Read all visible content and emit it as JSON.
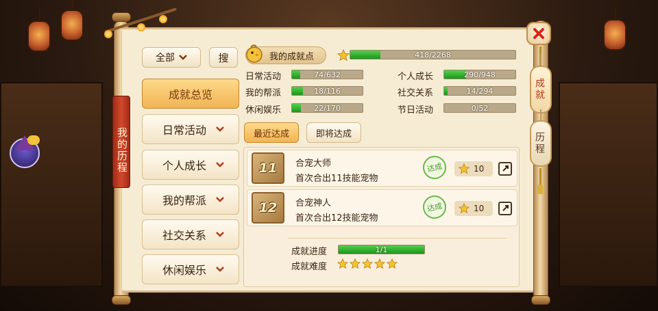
{
  "sidebar_banner": "我的历程",
  "right_tabs": [
    "成就",
    "历程"
  ],
  "filter": {
    "label": "全部",
    "search_label": "搜"
  },
  "menu": [
    {
      "label": "成就总览",
      "active": true
    },
    {
      "label": "日常活动",
      "active": false
    },
    {
      "label": "个人成长",
      "active": false
    },
    {
      "label": "我的帮派",
      "active": false
    },
    {
      "label": "社交关系",
      "active": false
    },
    {
      "label": "休闲娱乐",
      "active": false
    }
  ],
  "header": {
    "my_points_label": "我的成就点",
    "total": {
      "text": "418/2268",
      "progress": 0.184
    }
  },
  "categories": [
    {
      "label": "日常活动",
      "text": "74/632",
      "progress": 0.117
    },
    {
      "label": "个人成长",
      "text": "290/948",
      "progress": 0.306
    },
    {
      "label": "我的帮派",
      "text": "18/116",
      "progress": 0.155
    },
    {
      "label": "社交关系",
      "text": "14/294",
      "progress": 0.048
    },
    {
      "label": "休闲娱乐",
      "text": "22/170",
      "progress": 0.129
    },
    {
      "label": "节日活动",
      "text": "0/52",
      "progress": 0.0
    }
  ],
  "tabs": {
    "recent": "最近达成",
    "upcoming": "即将达成"
  },
  "achievements": [
    {
      "level": "11",
      "name": "合宠大师",
      "desc": "首次合出11技能宠物",
      "status": "达成",
      "points": "10"
    },
    {
      "level": "12",
      "name": "合宠神人",
      "desc": "首次合出12技能宠物",
      "status": "达成",
      "points": "10"
    }
  ],
  "detail": {
    "progress_label": "成就进度",
    "progress_text": "1/1",
    "progress": 1.0,
    "difficulty_label": "成就难度",
    "difficulty_stars": 5
  },
  "colors": {
    "progress_green": "#2fb32a",
    "accent_orange": "#f0b454",
    "banner_red": "#c0391c"
  }
}
